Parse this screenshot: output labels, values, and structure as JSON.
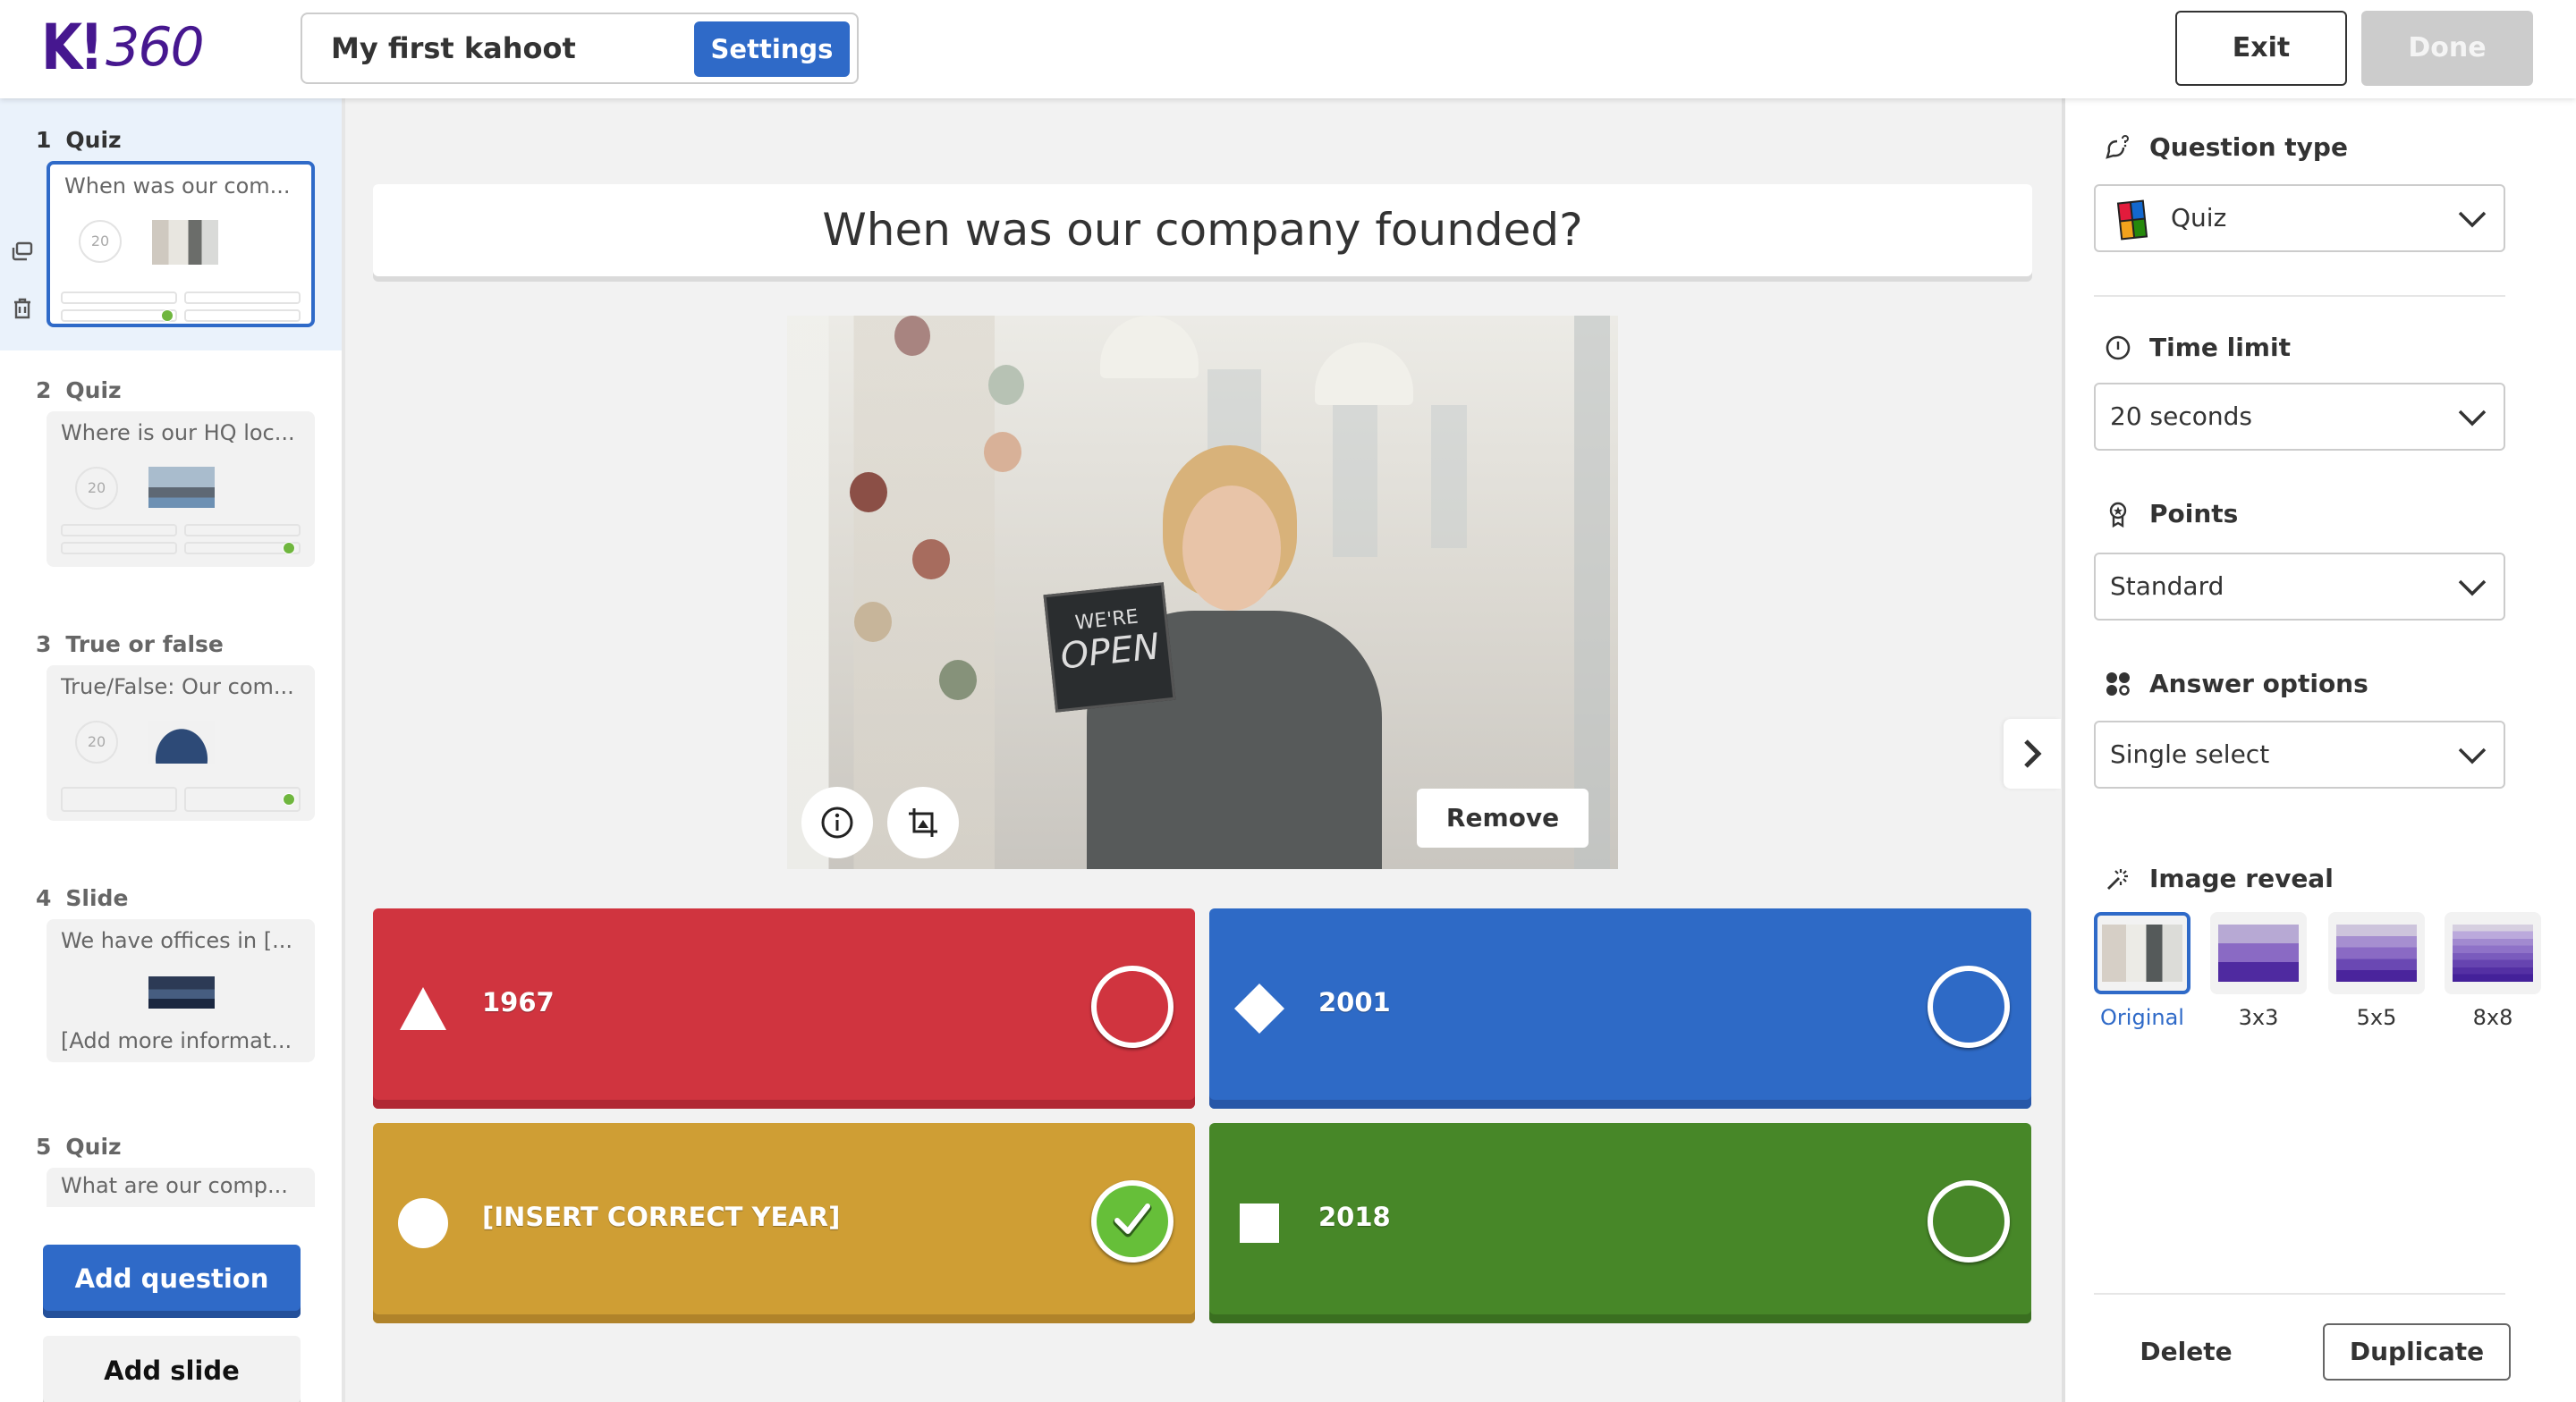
{
  "header": {
    "logo_k": "K!",
    "logo_suffix": "360",
    "kahoot_title": "My first kahoot",
    "settings_label": "Settings",
    "exit_label": "Exit",
    "done_label": "Done"
  },
  "sidebar": {
    "items": [
      {
        "number": "1",
        "type": "Quiz",
        "preview_text": "When was our com...",
        "time": "20",
        "thumb": "woman-open-sign",
        "active": true,
        "correct_answer_index": 2
      },
      {
        "number": "2",
        "type": "Quiz",
        "preview_text": "Where is our HQ loc...",
        "time": "20",
        "thumb": "city-skyline",
        "active": false,
        "correct_answer_index": 3
      },
      {
        "number": "3",
        "type": "True or false",
        "preview_text": "True/False: Our com...",
        "time": "20",
        "thumb": "europe-globe",
        "active": false,
        "correct_answer_index": 1
      },
      {
        "number": "4",
        "type": "Slide",
        "preview_text": "We have offices in [...",
        "body_text": "[Add more informat...",
        "thumb": "night-city",
        "active": false
      },
      {
        "number": "5",
        "type": "Quiz",
        "preview_text": "What are our comp...",
        "active": false
      }
    ],
    "add_question_label": "Add question",
    "add_slide_label": "Add slide"
  },
  "editor": {
    "question": "When was our company founded?",
    "media": {
      "sign_line1": "WE'RE",
      "sign_line2": "OPEN",
      "remove_label": "Remove"
    },
    "answers": [
      {
        "text": "1967",
        "shape": "triangle",
        "color": "#d0343f",
        "correct": false
      },
      {
        "text": "2001",
        "shape": "diamond",
        "color": "#2e6ac6",
        "correct": false
      },
      {
        "text": "[INSERT CORRECT YEAR]",
        "shape": "circle",
        "color": "#cf9e34",
        "correct": true
      },
      {
        "text": "2018",
        "shape": "square",
        "color": "#478728",
        "correct": false
      }
    ]
  },
  "right_panel": {
    "question_type": {
      "label": "Question type",
      "value": "Quiz"
    },
    "time_limit": {
      "label": "Time limit",
      "value": "20 seconds"
    },
    "points": {
      "label": "Points",
      "value": "Standard"
    },
    "answer_options": {
      "label": "Answer options",
      "value": "Single select"
    },
    "image_reveal": {
      "label": "Image reveal",
      "options": [
        {
          "label": "Original",
          "selected": true
        },
        {
          "label": "3x3",
          "selected": false
        },
        {
          "label": "5x5",
          "selected": false
        },
        {
          "label": "8x8",
          "selected": false
        }
      ]
    },
    "delete_label": "Delete",
    "duplicate_label": "Duplicate"
  },
  "colors": {
    "brand_purple": "#46178f",
    "primary_blue": "#2f6ac8",
    "correct_green": "#66bf39"
  }
}
